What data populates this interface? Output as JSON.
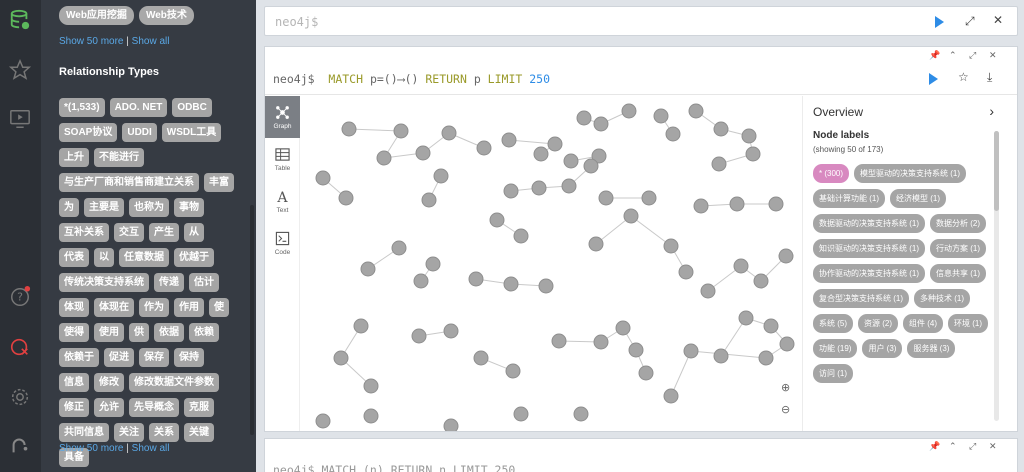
{
  "iconbar": {
    "icons": [
      "database-icon",
      "star-icon",
      "monitor-play-icon",
      "help-icon",
      "sync-error-icon",
      "gear-icon",
      "neo4j-logo-icon"
    ]
  },
  "sidebar": {
    "top_chips": [
      "Web应用挖掘",
      "Web技术"
    ],
    "show_more_1": "Show 50 more",
    "sep": "|",
    "show_all_1": "Show all",
    "relationship_title": "Relationship Types",
    "relationship_types": [
      "*(1,533)",
      "ADO. NET",
      "ODBC",
      "SOAP协议",
      "UDDI",
      "WSDL工具",
      "上升",
      "不能进行",
      "与生产厂商和销售商建立关系",
      "丰富",
      "为",
      "主要是",
      "也称为",
      "事物",
      "互补关系",
      "交互",
      "产生",
      "从",
      "代表",
      "以",
      "任意数据",
      "优越于",
      "传统决策支持系统",
      "传递",
      "估计",
      "体现",
      "体现在",
      "作为",
      "作用",
      "使",
      "使得",
      "使用",
      "供",
      "依据",
      "依赖",
      "依赖于",
      "促进",
      "保存",
      "保持",
      "信息",
      "修改",
      "修改数据文件参数",
      "修正",
      "允许",
      "先导概念",
      "克服",
      "共同信息",
      "关注",
      "关系",
      "关键",
      "具备"
    ],
    "show_more_2": "Show 50 more",
    "show_all_2": "Show all"
  },
  "editor": {
    "prompt": "neo4j$"
  },
  "frame1": {
    "prompt": "neo4j$",
    "query_kw1": "MATCH",
    "query_mid": " p=()⟶() ",
    "query_kw2": "RETURN",
    "query_p": " p ",
    "query_kw3": "LIMIT",
    "query_num": "250",
    "views": [
      "Graph",
      "Table",
      "Text",
      "Code"
    ],
    "overview": {
      "title": "Overview",
      "node_labels_title": "Node labels",
      "count": "(showing 50 of 173)",
      "labels": [
        "* (300)",
        "模型驱动的决策支持系统 (1)",
        "基础计算功能 (1)",
        "经济模型 (1)",
        "数据驱动的决策支持系统 (1)",
        "数据分析 (2)",
        "知识驱动的决策支持系统 (1)",
        "行动方案 (1)",
        "协作驱动的决策支持系统 (1)",
        "信息共享 (1)",
        "复合型决策支持系统 (1)",
        "多种技术 (1)",
        "系统 (5)",
        "资源 (2)",
        "组件 (4)",
        "环境 (1)",
        "功能 (19)",
        "用户 (3)",
        "服务器 (3)",
        "访问 (1)"
      ]
    }
  },
  "frame2": {
    "query": "neo4j$ MATCH (n) RETURN n LIMIT 250"
  },
  "colors": {
    "accent": "#2e8ce6",
    "node": "#a5a5a5",
    "first_label": "#d889c0"
  }
}
